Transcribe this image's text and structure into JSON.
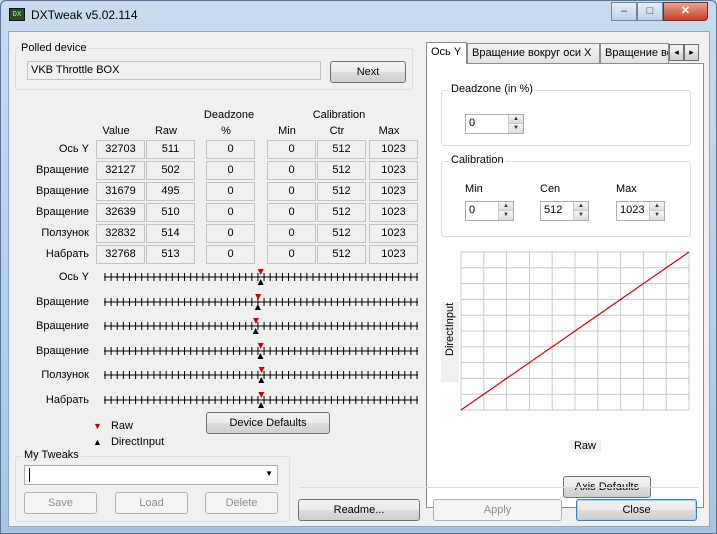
{
  "window": {
    "title": "DXTweak v5.02.114",
    "minimize": "–",
    "maximize": "□",
    "close": "✕"
  },
  "polled": {
    "group_label": "Polled device",
    "device_name": "VKB Throttle BOX",
    "next_label": "Next"
  },
  "table": {
    "group_deadzone": "Deadzone",
    "group_calibration": "Calibration",
    "col_value": "Value",
    "col_raw": "Raw",
    "col_deadzone_pct": "%",
    "col_min": "Min",
    "col_ctr": "Ctr",
    "col_max": "Max",
    "rows": [
      {
        "label": "Ось Y",
        "value": "32703",
        "raw": "511",
        "dz": "0",
        "min": "0",
        "ctr": "512",
        "max": "1023"
      },
      {
        "label": "Вращение",
        "value": "32127",
        "raw": "502",
        "dz": "0",
        "min": "0",
        "ctr": "512",
        "max": "1023"
      },
      {
        "label": "Вращение",
        "value": "31679",
        "raw": "495",
        "dz": "0",
        "min": "0",
        "ctr": "512",
        "max": "1023"
      },
      {
        "label": "Вращение",
        "value": "32639",
        "raw": "510",
        "dz": "0",
        "min": "0",
        "ctr": "512",
        "max": "1023"
      },
      {
        "label": "Ползунок",
        "value": "32832",
        "raw": "514",
        "dz": "0",
        "min": "0",
        "ctr": "512",
        "max": "1023"
      },
      {
        "label": "Набрать",
        "value": "32768",
        "raw": "513",
        "dz": "0",
        "min": "0",
        "ctr": "512",
        "max": "1023"
      }
    ]
  },
  "sliders": [
    {
      "label": "Ось Y",
      "raw": 0.499,
      "di": 0.499
    },
    {
      "label": "Вращение",
      "raw": 0.491,
      "di": 0.49
    },
    {
      "label": "Вращение",
      "raw": 0.484,
      "di": 0.483
    },
    {
      "label": "Вращение",
      "raw": 0.499,
      "di": 0.498
    },
    {
      "label": "Ползунок",
      "raw": 0.502,
      "di": 0.501
    },
    {
      "label": "Набрать",
      "raw": 0.501,
      "di": 0.5
    }
  ],
  "legend": {
    "raw": "Raw",
    "directinput": "DirectInput",
    "raw_color": "#cc0000",
    "di_color": "#000000"
  },
  "device_defaults_label": "Device Defaults",
  "tweaks": {
    "group_label": "My Tweaks",
    "combo_value": "",
    "save": "Save",
    "load": "Load",
    "delete": "Delete"
  },
  "tabs": {
    "items": [
      "Ось Y",
      "Вращение вокруг оси X",
      "Вращение во"
    ],
    "prev": "◂",
    "next": "▸"
  },
  "axis_panel": {
    "deadzone_label": "Deadzone (in %)",
    "deadzone_value": "0",
    "calibration_label": "Calibration",
    "min_label": "Min",
    "min_value": "0",
    "cen_label": "Cen",
    "cen_value": "512",
    "max_label": "Max",
    "max_value": "1023",
    "graph_y_label": "DirectInput",
    "graph_x_label": "Raw",
    "line_color": "#cc0000",
    "axis_defaults_label": "Axis Defaults"
  },
  "footer": {
    "readme": "Readme...",
    "apply": "Apply",
    "close": "Close"
  }
}
